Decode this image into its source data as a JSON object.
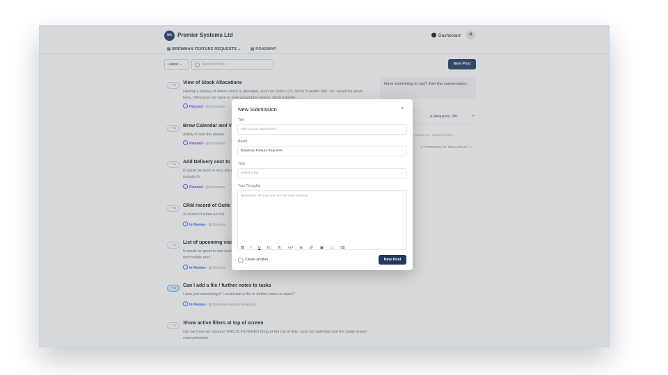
{
  "header": {
    "logo_text": "im",
    "company": "Premier Systems Ltd",
    "dashboard": "Dashboard",
    "avatar": "B",
    "board_nav": "▤ BREWMAN FEATURE REQUESTS ⌄",
    "roadmap": "▤ ROADMAP"
  },
  "toolbar": {
    "sort": "Latest ⌄",
    "search_placeholder": "Search Posts...",
    "new_post": "New Post"
  },
  "posts": [
    {
      "votes": "⌃ 9",
      "title": "View of Stock Allocations",
      "desc": "Having a display of where stock is allocated, such as Order 123, Stock Transfer 986, etc. would be great here. Otherwise we have to hunt around for orders, stock transfer...",
      "status": "Planned",
      "board": " • ▤ Brewman"
    },
    {
      "votes": "⌃ 6",
      "title": "Brew Calendar and V",
      "desc": "Ability to see the planne",
      "status": "Planned",
      "board": " • ▤ Brewman"
    },
    {
      "votes": "⌃ 4",
      "title": "Add Delivery cost to",
      "desc": "It would be food to reco the goods to include th",
      "status": "Planned",
      "board": " • ▤ Brewman"
    },
    {
      "votes": "⌃ 3",
      "title": "CRM record of Outle",
      "desc": "A record of when an out",
      "status": "In Review",
      "board": " • ▤ Brewma"
    },
    {
      "votes": "⌃ 2",
      "title": "List of upcoming visi",
      "desc": "It would be good to see such as reschedule and",
      "status": "In Review",
      "board": " • ▤ Brewma"
    },
    {
      "votes": "⌃ 3",
      "title": "Can I add a file / further notes to tasks",
      "desc": "I was just wondering if I could add a file or further notes to tasks?",
      "status": "In Review",
      "board": " • ▤ Brewman Feature Requests"
    },
    {
      "votes": "⌃ 2",
      "title": "Show active filters at top of screen",
      "desc": "can we have an obvious THIS IS FILTERED thing at the top of lists, such as materials and the badly drawn examplebelow",
      "status": "",
      "board": ""
    }
  ],
  "sidebar": {
    "join": "Have something to say? Join the conversation.",
    "requests": "e Requests",
    "badge": "108",
    "plus": "+",
    "links": "Contact us · Privacy Policy",
    "powered": "POWERED BY HELLONEXT ↗",
    "bolt": "⚡"
  },
  "modal": {
    "title": "New Submission",
    "close": "×",
    "title_label": "Title",
    "title_placeholder": "Title of your submission",
    "board_label": "Board",
    "board_value": "Brewman Feature Requests",
    "tags_label": "Tags",
    "tags_placeholder": "Select a tag",
    "thoughts_label": "Your Thoughts",
    "thoughts_placeholder": "Remember, the more you tell, the more we know",
    "chevron": "⌄",
    "toolbar": [
      "B",
      "I",
      "U",
      "H₁",
      "H₂",
      "</>",
      "☰",
      "🔗",
      "▣",
      "▭",
      "⌫"
    ],
    "create_another": "Create another",
    "submit": "New Post"
  },
  "colors": {
    "primary": "#1e3a5f",
    "planned": "#7c3aed",
    "in_review": "#2563eb",
    "frame_border": "#c8d6ea"
  }
}
